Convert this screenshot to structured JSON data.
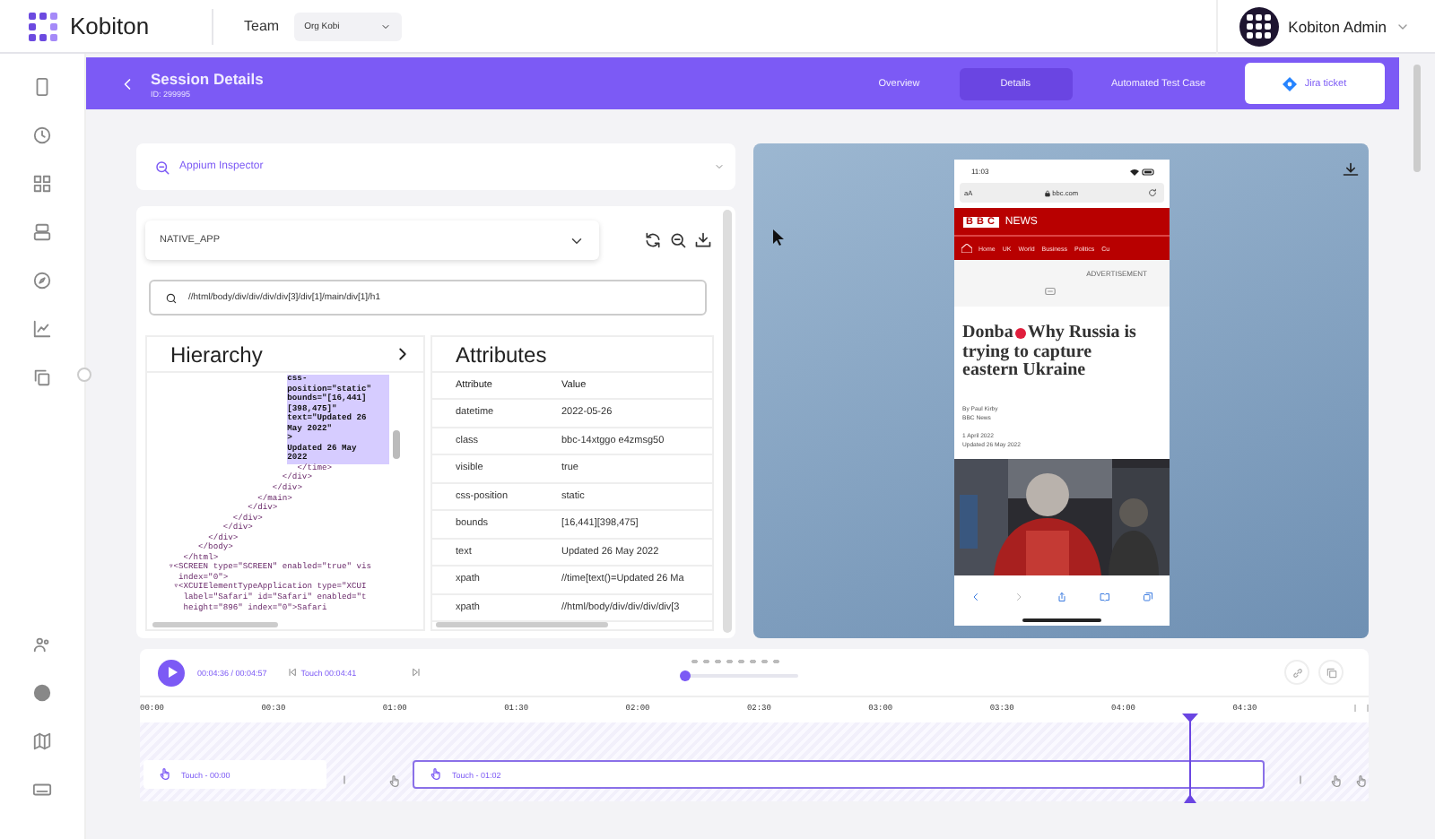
{
  "header": {
    "brand": "Kobiton",
    "team_label": "Team",
    "team": "Org Kobi",
    "user": "Kobiton Admin"
  },
  "session": {
    "title": "Session Details",
    "id": "ID: 299995",
    "tabs": [
      {
        "label": "Overview",
        "selected": false
      },
      {
        "label": "Details",
        "selected": true
      },
      {
        "label": "Automated Test Case",
        "selected": false
      }
    ],
    "jira_button": "Jira ticket"
  },
  "inspector": {
    "title": "Appium Inspector",
    "context": "NATIVE_APP",
    "xpath": "//html/body/div/div/div/div[3]/div[1]/main/div[1]/h1"
  },
  "hierarchy": {
    "title": "Hierarchy",
    "lines": [
      {
        "text": "                        css-",
        "selected": true
      },
      {
        "text": "                        position=\"static\"",
        "selected": true
      },
      {
        "text": "                        bounds=\"[16,441]",
        "selected": true
      },
      {
        "text": "                        [398,475]\"",
        "selected": true
      },
      {
        "text": "                        text=\"Updated 26",
        "selected": true
      },
      {
        "text": "                        May 2022\"",
        "selected": true
      },
      {
        "text": "                        >",
        "selected": true
      },
      {
        "text": "                        Updated 26 May",
        "selected": true
      },
      {
        "text": "                        2022",
        "selected": true
      },
      {
        "text": "                          </time>",
        "selected": false
      },
      {
        "text": "                       </div>",
        "selected": false
      },
      {
        "text": "                     </div>",
        "selected": false
      },
      {
        "text": "                  </main>",
        "selected": false
      },
      {
        "text": "                </div>",
        "selected": false
      },
      {
        "text": "             </div>",
        "selected": false
      },
      {
        "text": "           </div>",
        "selected": false
      },
      {
        "text": "        </div>",
        "selected": false
      },
      {
        "text": "      </body>",
        "selected": false
      },
      {
        "text": "   </html>",
        "selected": false
      },
      {
        "text": "▿<SCREEN type=\"SCREEN\" enabled=\"true\" vis",
        "selected": false
      },
      {
        "text": "  index=\"0\">",
        "selected": false
      },
      {
        "text": " ▿<XCUIElementTypeApplication type=\"XCUI",
        "selected": false
      },
      {
        "text": "   label=\"Safari\" id=\"Safari\" enabled=\"t",
        "selected": false
      },
      {
        "text": "   height=\"896\" index=\"0\">Safari",
        "selected": false
      }
    ]
  },
  "attributes": {
    "title": "Attributes",
    "columns": [
      "Attribute",
      "Value"
    ],
    "rows": [
      [
        "datetime",
        "2022-05-26"
      ],
      [
        "class",
        "bbc-14xtggo e4zmsg50"
      ],
      [
        "visible",
        "true"
      ],
      [
        "css-position",
        "static"
      ],
      [
        "bounds",
        "[16,441][398,475]"
      ],
      [
        "text",
        "Updated 26 May 2022"
      ],
      [
        "xpath",
        "//time[text()=Updated 26 Ma"
      ],
      [
        "xpath",
        "//html/body/div/div/div/div[3"
      ]
    ]
  },
  "device": {
    "clock": "11:03",
    "text_size": "aA",
    "url": "bbc.com",
    "logo": "BBC",
    "section": "NEWS",
    "nav": [
      "Home",
      "UK",
      "World",
      "Business",
      "Politics",
      "Cu"
    ],
    "ad_label": "ADVERTISEMENT",
    "headline_start": "Donba",
    "headline_lines": [
      "Why Russia is",
      "trying to capture",
      "eastern Ukraine"
    ],
    "byline": "By Paul Kirby",
    "source": "BBC News",
    "published": "1 April 2022",
    "updated": "Updated 26 May 2022"
  },
  "player": {
    "time": "00:04:36 / 00:04:57",
    "touch": "Touch 00:04:41",
    "zoom_slider": {
      "level": 0
    }
  },
  "timeline": {
    "ticks": [
      "00:00",
      "00:30",
      "01:00",
      "01:30",
      "02:00",
      "02:30",
      "03:00",
      "03:30",
      "04:00",
      "04:30"
    ],
    "playhead": {
      "level": 0.855
    },
    "events": [
      {
        "label": "Touch - 00:00",
        "selected": false
      },
      {
        "label": "Touch - 01:02",
        "selected": true
      }
    ]
  }
}
